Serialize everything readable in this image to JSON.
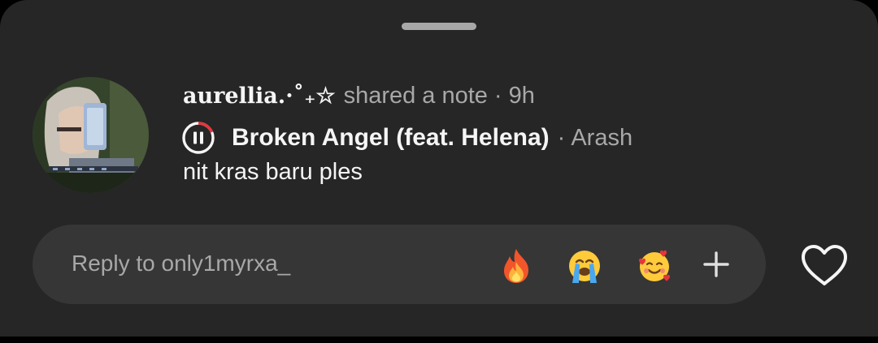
{
  "note": {
    "username": "aurellia.·˚₊☆",
    "action": "shared a note",
    "separator": "·",
    "time": "9h",
    "music": {
      "icon": "pause-icon",
      "title": "Broken Angel (feat. Helena)",
      "separator": "·",
      "artist": "Arash"
    },
    "text": "nit kras baru ples"
  },
  "reply": {
    "placeholder": "Reply to only1myrxa_",
    "reactions": [
      "🔥",
      "😭",
      "🥰"
    ],
    "more_icon": "plus-icon"
  },
  "like_icon": "heart-outline-icon",
  "colors": {
    "sheet_background": "#262626",
    "reply_background": "#363636",
    "primary_text": "#f5f5f5",
    "secondary_text": "#a8a8a8",
    "progress_accent": "#e8343c"
  }
}
